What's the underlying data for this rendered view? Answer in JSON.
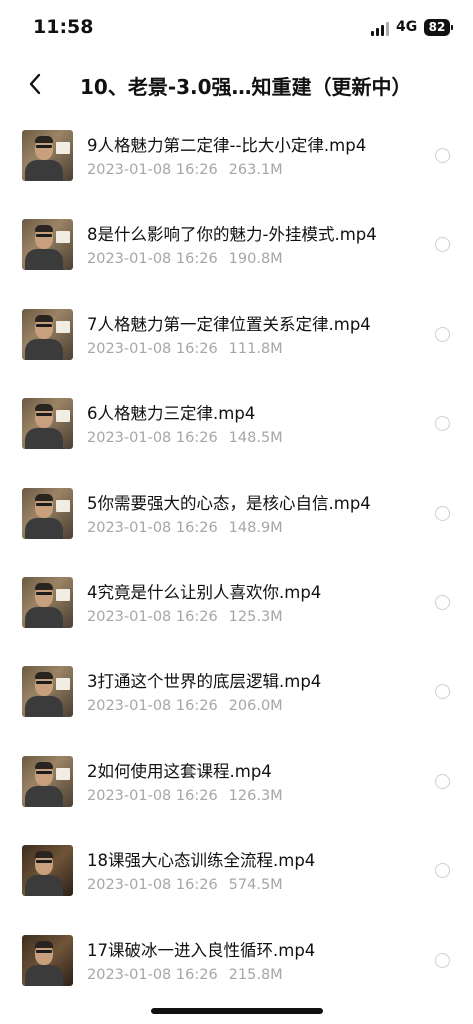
{
  "status_bar": {
    "time": "11:58",
    "network": "4G",
    "battery": "82",
    "signal_icon": "cellular-signal-icon"
  },
  "header": {
    "back_icon": "chevron-left-icon",
    "title": "10、老景-3.0强…知重建（更新中）"
  },
  "items": [
    {
      "title": "9人格魅力第二定律--比大小定律.mp4",
      "date": "2023-01-08 16:26",
      "size": "263.1M"
    },
    {
      "title": "8是什么影响了你的魅力-外挂模式.mp4",
      "date": "2023-01-08 16:26",
      "size": "190.8M"
    },
    {
      "title": "7人格魅力第一定律位置关系定律.mp4",
      "date": "2023-01-08 16:26",
      "size": "111.8M"
    },
    {
      "title": "6人格魅力三定律.mp4",
      "date": "2023-01-08 16:26",
      "size": "148.5M"
    },
    {
      "title": "5你需要强大的心态，是核心自信.mp4",
      "date": "2023-01-08 16:26",
      "size": "148.9M"
    },
    {
      "title": "4究竟是什么让别人喜欢你.mp4",
      "date": "2023-01-08 16:26",
      "size": "125.3M"
    },
    {
      "title": "3打通这个世界的底层逻辑.mp4",
      "date": "2023-01-08 16:26",
      "size": "206.0M"
    },
    {
      "title": "2如何使用这套课程.mp4",
      "date": "2023-01-08 16:26",
      "size": "126.3M"
    },
    {
      "title": "18课强大心态训练全流程.mp4",
      "date": "2023-01-08 16:26",
      "size": "574.5M"
    },
    {
      "title": "17课破冰一进入良性循环.mp4",
      "date": "2023-01-08 16:26",
      "size": "215.8M"
    }
  ],
  "colors": {
    "background": "#ffffff",
    "title_text": "#111111",
    "meta_text": "#a6a6a6",
    "radio_border": "#cfcfcf"
  }
}
